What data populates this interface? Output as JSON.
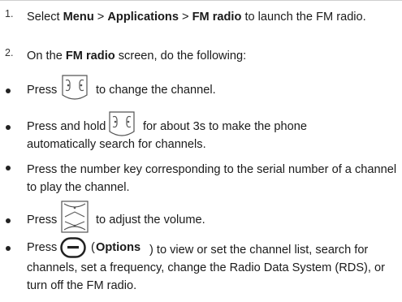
{
  "steps": [
    {
      "num": "1.",
      "parts": [
        "Select ",
        "Menu",
        " > ",
        "Applications",
        " > ",
        "FM radio",
        " to launch the FM radio."
      ]
    },
    {
      "num": "2.",
      "parts": [
        "On the ",
        "FM radio",
        " screen, do the following:"
      ]
    }
  ],
  "bullets": [
    {
      "before": "Press",
      "after": "to change the channel.",
      "icon": "navigation-left-right-keys-icon"
    },
    {
      "before": "Press and hold",
      "after": "for about 3s to make the phone",
      "line2": "automatically search for channels.",
      "icon": "navigation-left-right-keys-icon"
    },
    {
      "text": "Press the number key corresponding to the serial number of a channel to play the channel."
    },
    {
      "before": "Press",
      "after": "to adjust the volume.",
      "icon": "navigation-up-down-keys-icon"
    },
    {
      "before": "Press",
      "bold": "Options",
      "after": ") to view or set the channel list, search for channels, set a frequency, change the Radio Data System (RDS), or turn off the FM radio.",
      "icon": "left-soft-key-icon",
      "paren_open": "("
    }
  ]
}
